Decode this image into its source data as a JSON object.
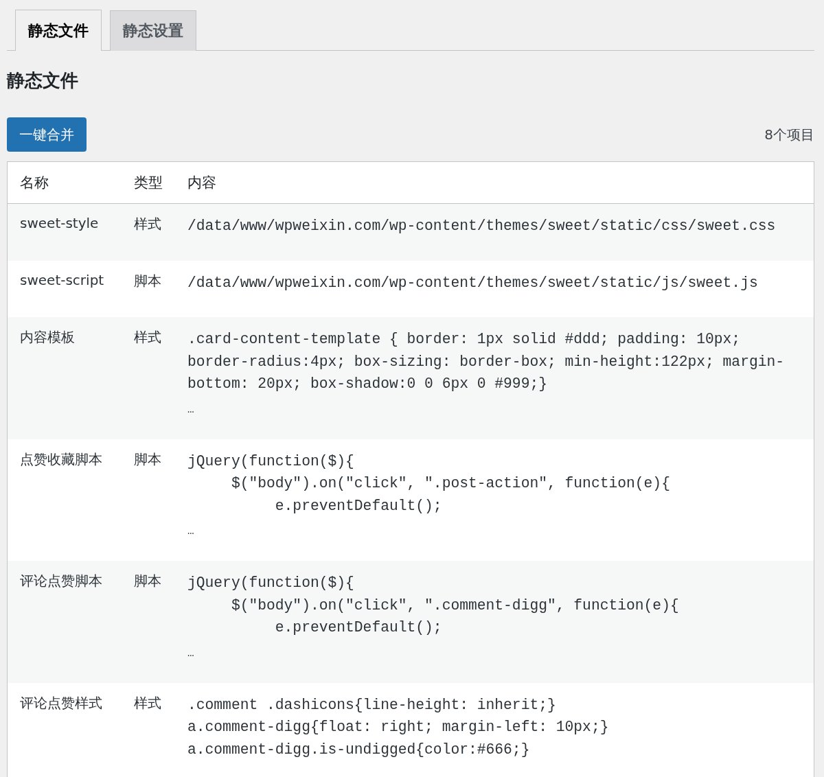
{
  "tabs": [
    {
      "label": "静态文件",
      "selected": true
    },
    {
      "label": "静态设置",
      "selected": false
    }
  ],
  "heading": "静态文件",
  "merge_button": "一键合并",
  "item_count": "8个项目",
  "table": {
    "columns": [
      "名称",
      "类型",
      "内容"
    ],
    "rows": [
      {
        "name": "sweet-style",
        "type": "样式",
        "content": "/data/www/wpweixin.com/wp-content/themes/sweet/static/css/sweet.css"
      },
      {
        "name": "sweet-script",
        "type": "脚本",
        "content": "/data/www/wpweixin.com/wp-content/themes/sweet/static/js/sweet.js"
      },
      {
        "name": "内容模板",
        "type": "样式",
        "content": ".card-content-template { border: 1px solid #ddd; padding: 10px; border-radius:4px; box-sizing: border-box; min-height:122px; margin-bottom: 20px; box-shadow:0 0 6px 0 #999;}",
        "more": "…"
      },
      {
        "name": "点赞收藏脚本",
        "type": "脚本",
        "content": "jQuery(function($){\n\t$(\"body\").on(\"click\", \".post-action\", function(e){\n\t\te.preventDefault();",
        "more": "…"
      },
      {
        "name": "评论点赞脚本",
        "type": "脚本",
        "content": "jQuery(function($){\n\t$(\"body\").on(\"click\", \".comment-digg\", function(e){\n\t\te.preventDefault();",
        "more": "…"
      },
      {
        "name": "评论点赞样式",
        "type": "样式",
        "content": ".comment .dashicons{line-height: inherit;}\na.comment-digg{float: right; margin-left: 10px;}\na.comment-digg.is-undigged{color:#666;}"
      }
    ]
  }
}
